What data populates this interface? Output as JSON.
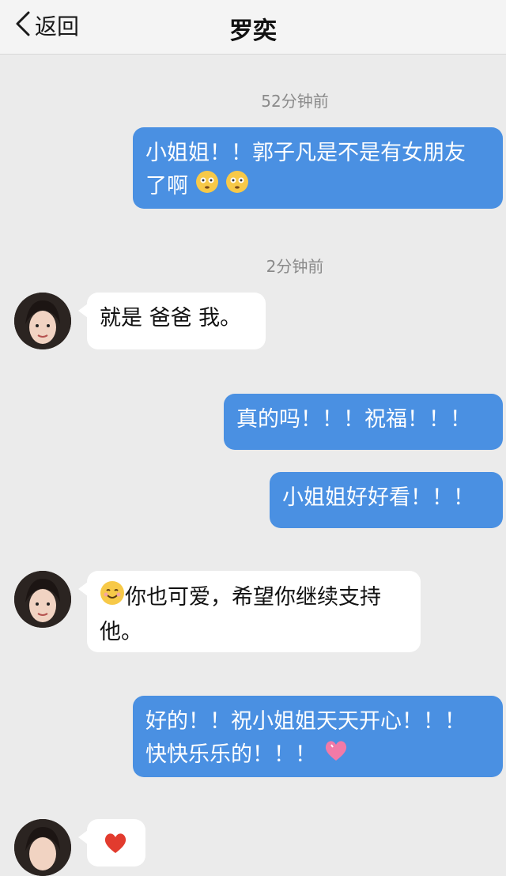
{
  "header": {
    "back_label": "返回",
    "title": "罗奕"
  },
  "messages": [
    {
      "kind": "time",
      "text": "52分钟前"
    },
    {
      "kind": "out",
      "line1": "小姐姐！！郭子凡是不是有女朋友",
      "line2": "了啊",
      "emoji": [
        "flushed-face-icon",
        "flushed-face-icon"
      ]
    },
    {
      "kind": "time",
      "text": "2分钟前"
    },
    {
      "kind": "in",
      "text": "就是 爸爸 我。"
    },
    {
      "kind": "out",
      "text": "真的吗！！！祝福！！！"
    },
    {
      "kind": "out",
      "text": "小姐姐好好看！！！"
    },
    {
      "kind": "in",
      "emoji": "smiling-face-icon",
      "line1": "你也可爱，希望你继续支持",
      "line2": "他。"
    },
    {
      "kind": "out",
      "line1": "好的！！祝小姐姐天天开心！！！",
      "line2": "快快乐乐的！！！",
      "emoji": "pink-heart-icon"
    },
    {
      "kind": "in",
      "emoji": "red-heart-icon"
    }
  ],
  "colors": {
    "outgoing_bubble": "#4a90e2",
    "incoming_bubble": "#ffffff",
    "background": "#ebebeb"
  }
}
